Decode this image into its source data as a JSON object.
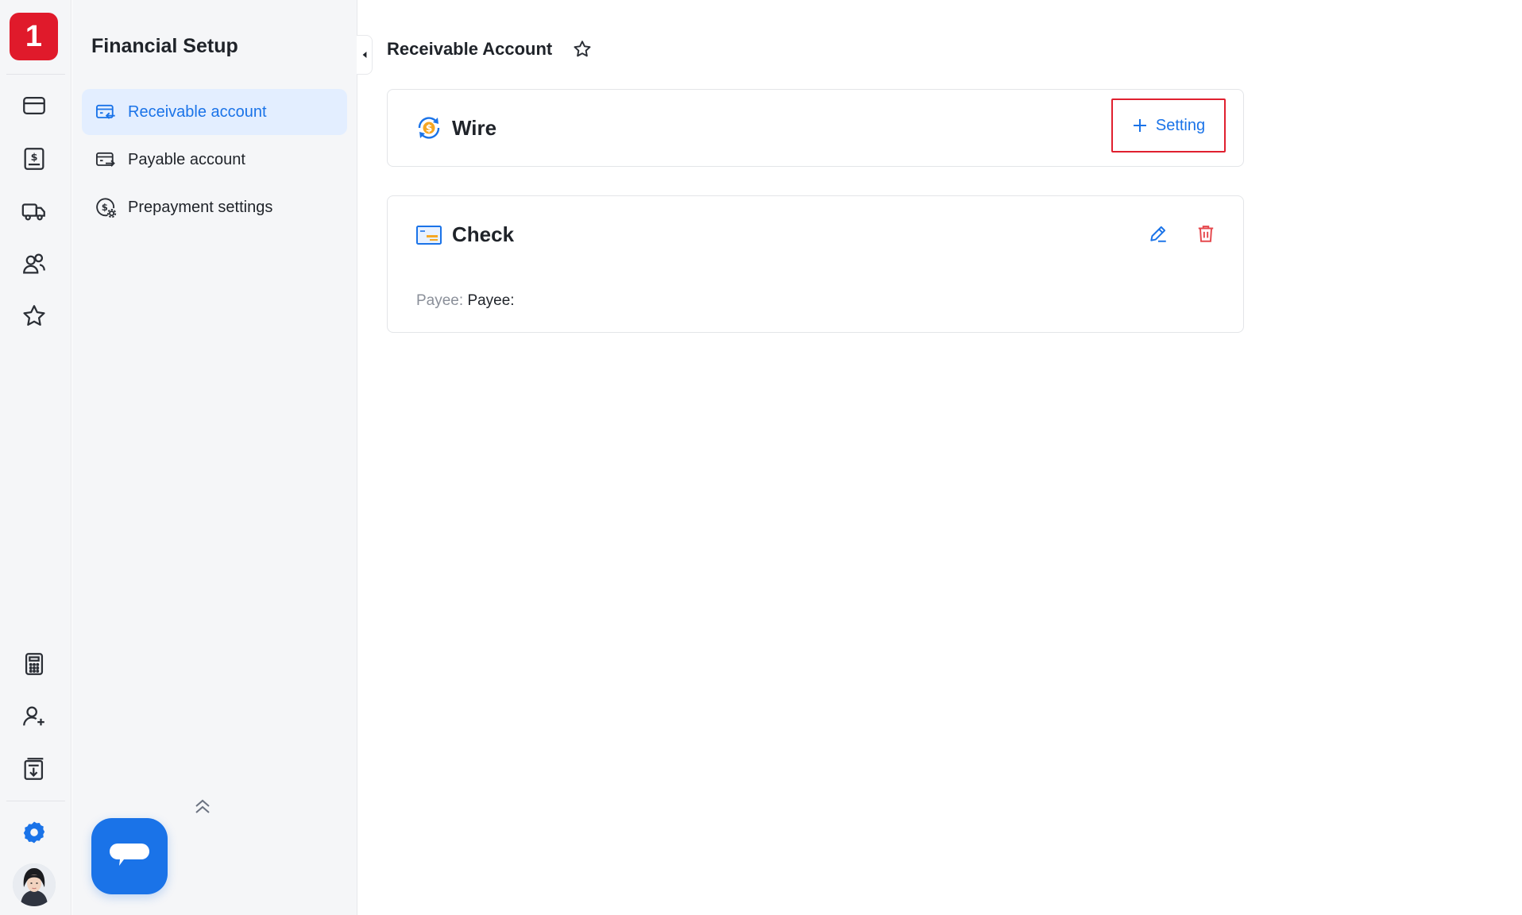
{
  "brand": {
    "logo_text": "1",
    "accent": "#1a73e8",
    "logo_color": "#e01a2b"
  },
  "rail": {
    "top_items": [
      {
        "name": "card-icon"
      },
      {
        "name": "invoice-dollar-icon"
      },
      {
        "name": "truck-icon"
      },
      {
        "name": "users-icon"
      },
      {
        "name": "star-icon"
      }
    ],
    "bottom_items": [
      {
        "name": "calculator-icon"
      },
      {
        "name": "add-user-icon"
      },
      {
        "name": "download-document-icon"
      },
      {
        "name": "settings-gear-icon",
        "active": true
      }
    ]
  },
  "sidebar": {
    "title": "Financial Setup",
    "items": [
      {
        "label": "Receivable account",
        "icon": "card-receive-icon",
        "active": true
      },
      {
        "label": "Payable account",
        "icon": "card-pay-icon",
        "active": false
      },
      {
        "label": "Prepayment settings",
        "icon": "dollar-gear-icon",
        "active": false
      }
    ]
  },
  "main": {
    "title": "Receivable Account",
    "cards": [
      {
        "title": "Wire",
        "icon": "wire-dollar-icon",
        "action_label": "Setting"
      },
      {
        "title": "Check",
        "icon": "check-icon",
        "payee_label": "Payee:",
        "payee_value": "Payee:"
      }
    ]
  }
}
